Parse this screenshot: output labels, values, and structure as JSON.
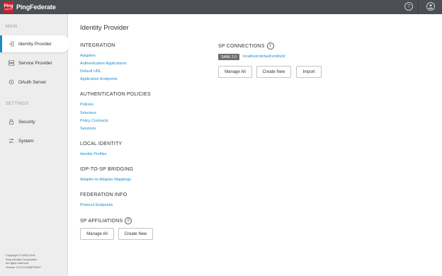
{
  "topbar": {
    "logo_badge": "Ping",
    "logo_badge_sub": "IDENTITY",
    "logo_text": "PingFederate",
    "help_icon": "?",
    "user_icon": "●"
  },
  "sidebar": {
    "sections": [
      "MAIN",
      "SETTINGS"
    ],
    "items": [
      {
        "label": "Identity Provider",
        "icon": "arrow-login-icon"
      },
      {
        "label": "Service Provider",
        "icon": "server-icon"
      },
      {
        "label": "OAuth Server",
        "icon": "oauth-icon"
      },
      {
        "label": "Security",
        "icon": "lock-icon"
      },
      {
        "label": "System",
        "icon": "sliders-icon"
      }
    ],
    "footer": [
      "Copyright © 2003-2019",
      "Ping Identity Corporation",
      "All rights reserved",
      "Version 9.3.0.5-SNAPSHOT"
    ]
  },
  "main": {
    "title": "Identity Provider",
    "integration": {
      "heading": "INTEGRATION",
      "links": [
        "Adapters",
        "Authentication Applications",
        "Default URL",
        "Application Endpoints"
      ]
    },
    "auth_policies": {
      "heading": "AUTHENTICATION POLICIES",
      "links": [
        "Policies",
        "Selectors",
        "Policy Contracts",
        "Sessions"
      ]
    },
    "local_identity": {
      "heading": "LOCAL IDENTITY",
      "links": [
        "Identity Profiles"
      ]
    },
    "idp_sp": {
      "heading": "IDP-TO-SP BRIDGING",
      "links": [
        "Adapter-to-Adapter Mappings"
      ]
    },
    "federation_info": {
      "heading": "FEDERATION INFO",
      "links": [
        "Protocol Endpoints"
      ]
    },
    "sp_affiliations": {
      "heading": "SP AFFILIATIONS",
      "count": "0",
      "buttons": [
        "Manage All",
        "Create New"
      ]
    },
    "sp_connections": {
      "heading": "SP CONNECTIONS",
      "count": "1",
      "badge": "SAML 2.0",
      "entity": "localhost:default:entityId",
      "buttons": [
        "Manage All",
        "Create New",
        "Import"
      ]
    }
  }
}
